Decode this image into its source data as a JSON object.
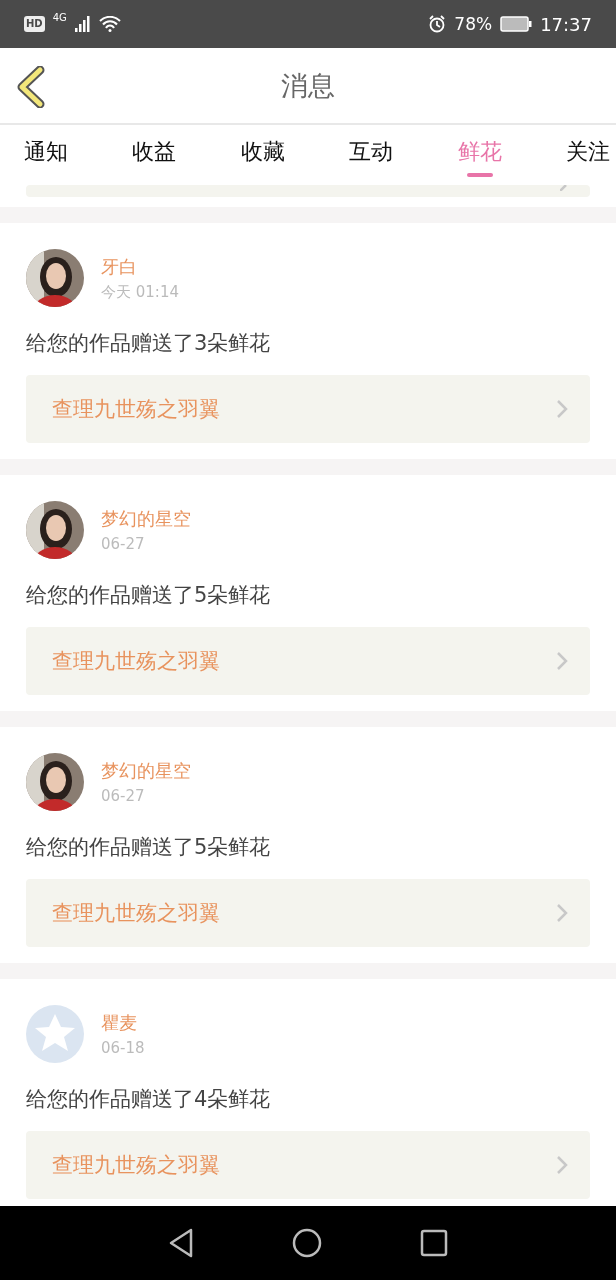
{
  "status_bar": {
    "hd": "HD",
    "network": "4G",
    "battery": "78%",
    "time": "17:37"
  },
  "header": {
    "title": "消息"
  },
  "tabs": [
    {
      "label": "通知",
      "selected": false
    },
    {
      "label": "收益",
      "selected": false
    },
    {
      "label": "收藏",
      "selected": false
    },
    {
      "label": "互动",
      "selected": false
    },
    {
      "label": "鲜花",
      "selected": true
    },
    {
      "label": "关注",
      "selected": false
    }
  ],
  "messages": [
    {
      "user": "牙白",
      "time": "今天 01:14",
      "text": "给您的作品赠送了3朵鲜花",
      "work": "查理九世殇之羽翼"
    },
    {
      "user": "梦幻的星空",
      "time": "06-27",
      "text": "给您的作品赠送了5朵鲜花",
      "work": "查理九世殇之羽翼"
    },
    {
      "user": "梦幻的星空",
      "time": "06-27",
      "text": "给您的作品赠送了5朵鲜花",
      "work": "查理九世殇之羽翼"
    },
    {
      "user": "瞿麦",
      "time": "06-18",
      "kind": "default",
      "text": "给您的作品赠送了4朵鲜花",
      "work": "查理九世殇之羽翼"
    }
  ]
}
